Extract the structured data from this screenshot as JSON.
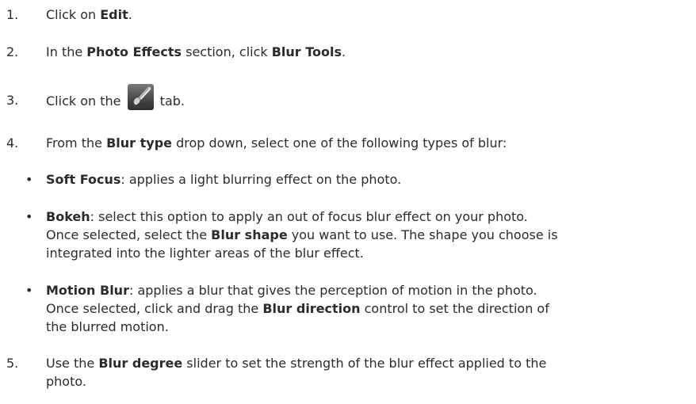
{
  "steps": [
    {
      "num": "1.",
      "pre": "Click on ",
      "bold": "Edit",
      "post": "."
    },
    {
      "num": "2.",
      "pre": "In the ",
      "bold": "Photo Effects",
      "mid": " section, click ",
      "bold2": "Blur Tools",
      "post": "."
    },
    {
      "num": "3.",
      "pre": "Click on the ",
      "post": " tab.",
      "icon": "blur-brush-tab-icon"
    },
    {
      "num": "4.",
      "pre": "From the ",
      "bold": "Blur type",
      "post": " drop down, select one of the following types of blur:"
    },
    {
      "num": "5.",
      "pre": "Use the ",
      "bold": "Blur degree",
      "post_line1": " slider to set the strength of the blur effect applied to the",
      "post_line2": "photo."
    }
  ],
  "blur_types": [
    {
      "name": "Soft Focus",
      "desc": ": applies a light blurring effect on the photo."
    },
    {
      "name": "Bokeh",
      "desc_line1": ": select this option to apply an out of focus blur effect on your photo.",
      "desc_line2_pre": "Once selected, select the ",
      "desc_line2_bold": "Blur shape",
      "desc_line2_post": " you want to use. The shape you choose is",
      "desc_line3": "integrated into the lighter areas of the blur effect."
    },
    {
      "name": "Motion Blur",
      "desc_line1": ": applies a blur that gives the perception of motion in the photo.",
      "desc_line2_pre": "Once selected, click and drag the ",
      "desc_line2_bold": "Blur direction",
      "desc_line2_post": " control to set the direction of",
      "desc_line3": "the blurred motion."
    }
  ],
  "bullet_char": "•"
}
